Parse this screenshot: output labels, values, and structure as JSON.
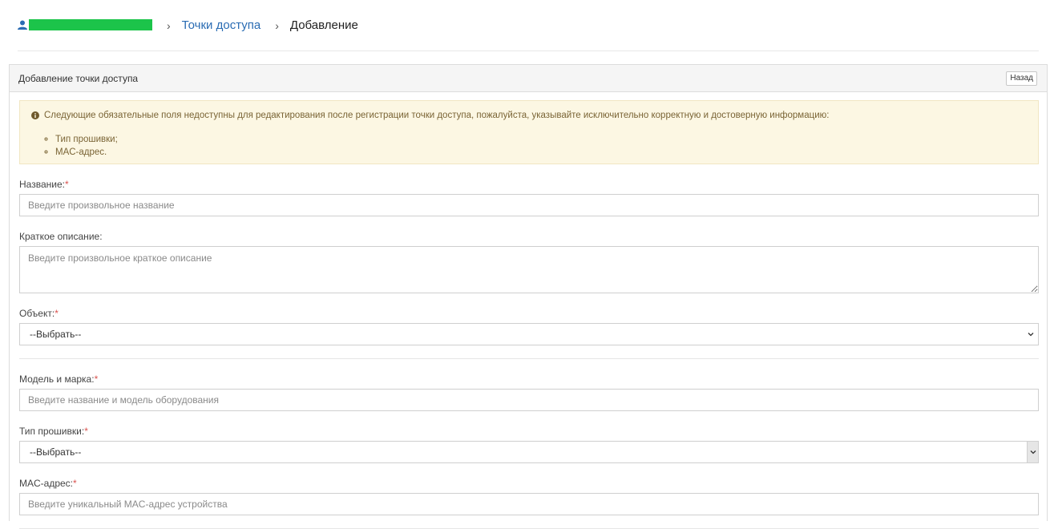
{
  "breadcrumb": {
    "home_redacted": "",
    "separator": "›",
    "access_points": "Точки доступа",
    "current": "Добавление"
  },
  "panel": {
    "title": "Добавление точки доступа",
    "back_label": "Назад"
  },
  "alert": {
    "icon": "info-circle-icon",
    "text": "Следующие обязательные поля недоступны для редактирования после регистрации точки доступа, пожалуйста, указывайте исключительно корректную и достоверную информацию:",
    "items": [
      "Тип прошивки;",
      "MAC-адрес."
    ]
  },
  "form": {
    "name": {
      "label": "Название:",
      "required_mark": "*",
      "placeholder": "Введите произвольное название"
    },
    "description": {
      "label": "Краткое описание:",
      "placeholder": "Введите произвольное краткое описание"
    },
    "object": {
      "label": "Объект:",
      "required_mark": "*",
      "selected": "--Выбрать--"
    },
    "model": {
      "label": "Модель и марка:",
      "required_mark": "*",
      "placeholder": "Введите название и модель оборудования"
    },
    "firmware": {
      "label": "Тип прошивки:",
      "required_mark": "*",
      "selected": "--Выбрать--"
    },
    "mac": {
      "label": "MAC-адрес:",
      "required_mark": "*",
      "placeholder": "Введите уникальный MAC-адрес устройства"
    }
  },
  "colors": {
    "link": "#2a6cb3",
    "required": "#d9534f",
    "alert_bg": "#fcf7e3",
    "redaction": "#1cc44a"
  }
}
